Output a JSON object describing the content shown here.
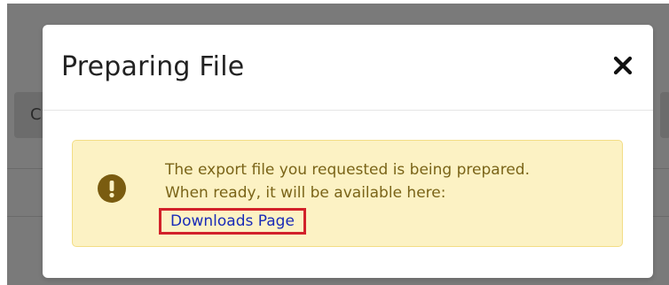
{
  "background": {
    "partial_button_label": "C"
  },
  "modal": {
    "title": "Preparing File",
    "close_icon": "close-icon",
    "alert": {
      "icon": "exclamation-circle-icon",
      "line1": "The export file you requested is being prepared.",
      "line2": "When ready, it will be available here:",
      "link_label": "Downloads Page"
    }
  },
  "colors": {
    "overlay": "#7a7a7a",
    "alert_background": "#fcf2c4",
    "alert_border": "#f3dd85",
    "alert_text": "#7a6418",
    "alert_icon": "#7a5c10",
    "link": "#1a2bb8",
    "highlight_box": "#d2222a"
  }
}
